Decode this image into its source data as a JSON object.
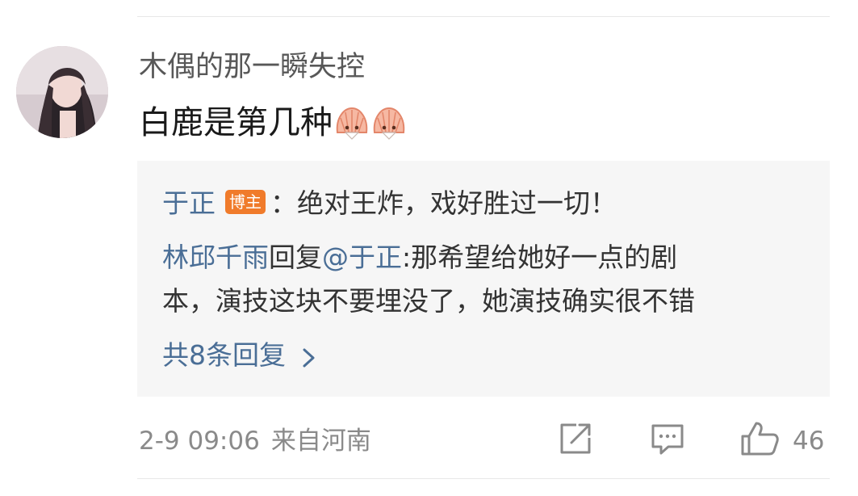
{
  "comment": {
    "username": "木偶的那一瞬失控",
    "text": "白鹿是第几种",
    "emojis": [
      "shell-fan-emoji",
      "shell-fan-emoji"
    ]
  },
  "replies": {
    "author_reply": {
      "author": "于正",
      "badge": "博主",
      "text": "：绝对王炸，戏好胜过一切！"
    },
    "reply2": {
      "author": "林邱千雨",
      "action": "回复",
      "mention": "@于正",
      "text_line1": ":那希望给她好一点的剧",
      "text_line2": "本，演技这块不要埋没了，她演技确实很不错"
    },
    "more_label": "共8条回复"
  },
  "footer": {
    "datetime": "2-9 09:06",
    "location": "来自河南",
    "like_count": "46"
  },
  "icons": {
    "share": "share-icon",
    "comment": "comment-icon",
    "like": "thumbs-up-icon"
  },
  "colors": {
    "link": "#4a6e96",
    "badge": "#f07b2b",
    "reply_bg": "#f6f6f6",
    "meta": "#8a8a8a"
  }
}
